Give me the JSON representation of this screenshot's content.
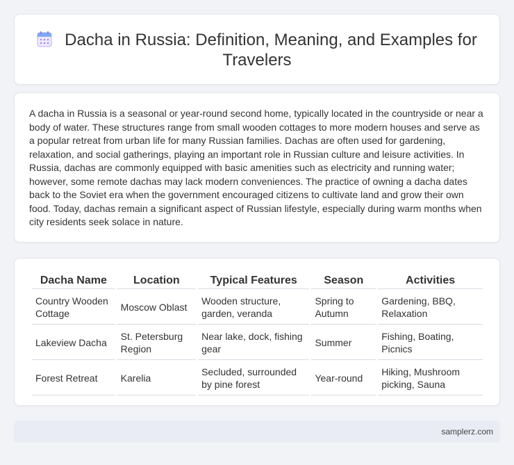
{
  "header": {
    "title": "Dacha in Russia: Definition, Meaning, and Examples for Travelers",
    "icon": "calendar-icon",
    "icon_color": "#7b6fd6"
  },
  "intro": {
    "text": "A dacha in Russia is a seasonal or year-round second home, typically located in the countryside or near a body of water. These structures range from small wooden cottages to more modern houses and serve as a popular retreat from urban life for many Russian families. Dachas are often used for gardening, relaxation, and social gatherings, playing an important role in Russian culture and leisure activities. In Russia, dachas are commonly equipped with basic amenities such as electricity and running water; however, some remote dachas may lack modern conveniences. The practice of owning a dacha dates back to the Soviet era when the government encouraged citizens to cultivate land and grow their own food. Today, dachas remain a significant aspect of Russian lifestyle, especially during warm months when city residents seek solace in nature."
  },
  "table": {
    "headers": [
      "Dacha Name",
      "Location",
      "Typical Features",
      "Season",
      "Activities"
    ],
    "rows": [
      [
        "Country Wooden Cottage",
        "Moscow Oblast",
        "Wooden structure, garden, veranda",
        "Spring to Autumn",
        "Gardening, BBQ, Relaxation"
      ],
      [
        "Lakeview Dacha",
        "St. Petersburg Region",
        "Near lake, dock, fishing gear",
        "Summer",
        "Fishing, Boating, Picnics"
      ],
      [
        "Forest Retreat",
        "Karelia",
        "Secluded, surrounded by pine forest",
        "Year-round",
        "Hiking, Mushroom picking, Sauna"
      ]
    ]
  },
  "footer": {
    "site": "samplerz.com"
  }
}
